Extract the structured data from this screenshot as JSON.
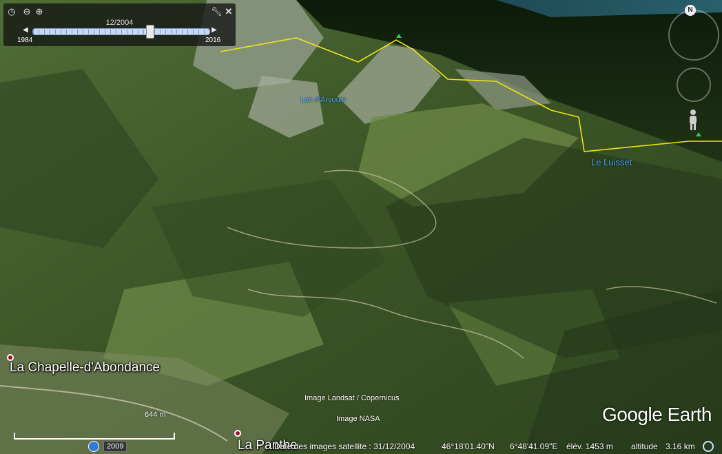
{
  "time_slider": {
    "current_date": "12/2004",
    "start_year": "1984",
    "end_year": "2016",
    "position": 0.66,
    "step_back": "◀",
    "step_forward": "▶",
    "clock_icon": "clock-icon",
    "zoom_out_icon": "zoom-out-icon",
    "zoom_in_icon": "zoom-in-icon",
    "settings_icon": "wrench-icon",
    "close_icon": "close-icon"
  },
  "navigation": {
    "north_label": "N",
    "look_icon": "look-joystick-icon",
    "move_icon": "move-joystick-icon",
    "street_view_icon": "pegman-icon"
  },
  "labels": {
    "lake": "Lac d'Arvouin",
    "ridge": "Le Luisset",
    "town_left": "La Chapelle-d'Abondance",
    "town_bottom": "La Panthe"
  },
  "credits": {
    "landsat": "Image Landsat / Copernicus",
    "nasa": "Image NASA",
    "logo": "Google Earth"
  },
  "scale": {
    "label": "644 m"
  },
  "status_bar": {
    "history_year": "2009",
    "imagery_date": "Date des images satellite : 31/12/2004",
    "latitude": "46°18'01.40\"N",
    "longitude": "6°48'41.09\"E",
    "elevation": "élév. 1453 m",
    "altitude_label": "altitude",
    "altitude_value": "3.16 km"
  },
  "colors": {
    "boundary_line": "#f2e21c",
    "label_blue": "#4aa8ff",
    "marker": "#9c1020"
  }
}
